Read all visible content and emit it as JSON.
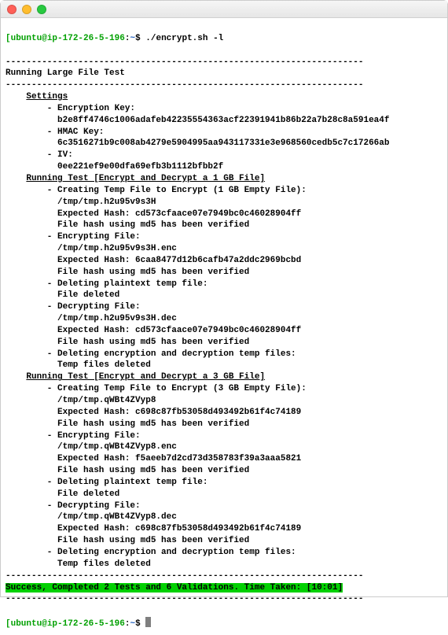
{
  "prompt": {
    "br_open": "[",
    "user_host": "ubuntu@ip-172-26-5-196",
    "colon": ":",
    "path": "~",
    "dollar": "$ ",
    "br_close": "]"
  },
  "cmd": "./encrypt.sh -l",
  "divider1": "---------------------------------------------------------------------",
  "divider2": "---------------------------------------------------------------------",
  "divider3": "---------------------------------------------------------------------",
  "divider4": "---------------------------------------------------------------------",
  "title": "Running Large File Test",
  "settings": {
    "heading": "Settings",
    "enc_key_label": "- Encryption Key:",
    "enc_key": "b2e8ff4746c1006adafeb42235554363acf22391941b86b22a7b28c8a591ea4f",
    "hmac_label": "- HMAC Key:",
    "hmac": "6c3516271b9c008ab4279e5904995aa943117331e3e968560cedb5c7c17266ab",
    "iv_label": "- IV:",
    "iv": "0ee221ef9e00dfa69efb3b1112bfbb2f"
  },
  "test1": {
    "heading": "Running Test [Encrypt and Decrypt a 1 GB File]",
    "create_label": "- Creating Temp File to Encrypt (1 GB Empty File):",
    "tmp": "/tmp/tmp.h2u95v9s3H",
    "exp_hash1": "Expected Hash: cd573cfaace07e7949bc0c46028904ff",
    "verified": "File hash using md5 has been verified",
    "enc_label": "- Encrypting File:",
    "tmp_enc": "/tmp/tmp.h2u95v9s3H.enc",
    "exp_hash2": "Expected Hash: 6caa8477d12b6cafb47a2ddc2969bcbd",
    "del_plain_label": "- Deleting plaintext temp file:",
    "file_deleted": "File deleted",
    "dec_label": "- Decrypting File:",
    "tmp_dec": "/tmp/tmp.h2u95v9s3H.dec",
    "exp_hash3": "Expected Hash: cd573cfaace07e7949bc0c46028904ff",
    "del_all_label": "- Deleting encryption and decryption temp files:",
    "temp_deleted": "Temp files deleted"
  },
  "test2": {
    "heading": "Running Test [Encrypt and Decrypt a 3 GB File]",
    "create_label": "- Creating Temp File to Encrypt (3 GB Empty File):",
    "tmp": "/tmp/tmp.qWBt4ZVyp8",
    "exp_hash1": "Expected Hash: c698c87fb53058d493492b61f4c74189",
    "verified": "File hash using md5 has been verified",
    "enc_label": "- Encrypting File:",
    "tmp_enc": "/tmp/tmp.qWBt4ZVyp8.enc",
    "exp_hash2": "Expected Hash: f5aeeb7d2cd73d358783f39a3aaa5821",
    "del_plain_label": "- Deleting plaintext temp file:",
    "file_deleted": "File deleted",
    "dec_label": "- Decrypting File:",
    "tmp_dec": "/tmp/tmp.qWBt4ZVyp8.dec",
    "exp_hash3": "Expected Hash: c698c87fb53058d493492b61f4c74189",
    "del_all_label": "- Deleting encryption and decryption temp files:",
    "temp_deleted": "Temp files deleted"
  },
  "success": "Success, Completed 2 Tests and 6 Validations. Time Taken: [10:01]"
}
